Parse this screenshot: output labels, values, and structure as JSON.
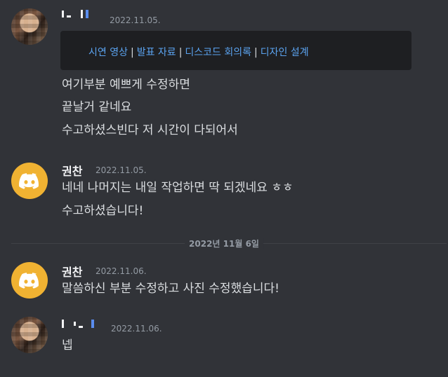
{
  "messages": [
    {
      "author_display": "",
      "timestamp": "2022.11.05.",
      "embed_links": [
        "시연 영상",
        "발표 자료",
        "디스코드 회의록",
        "디자인 설계"
      ],
      "embed_separator": "|",
      "lines": [
        "여기부분 예쁘게 수정하면",
        "끝날거 같네요",
        "수고하셨스빈다 저 시간이 다되어서"
      ]
    },
    {
      "author": "권찬",
      "timestamp": "2022.11.05.",
      "lines": [
        "네네 나머지는 내일 작업하면 딱 되겠네요 ㅎㅎ",
        "수고하셨습니다!"
      ]
    },
    {
      "author": "권찬",
      "timestamp": "2022.11.06.",
      "lines": [
        "말씀하신 부분 수정하고 사진 수정했습니다!"
      ]
    },
    {
      "author_display": "",
      "timestamp": "2022.11.06.",
      "lines": [
        "넵"
      ]
    }
  ],
  "date_divider": "2022년 11월 6일",
  "colors": {
    "background": "#313338",
    "embed_bg": "#1e1f22",
    "link": "#5ba3f0",
    "discord_avatar": "#f0b232",
    "timestamp": "#949ba4"
  },
  "icons": [
    "discord-logo-icon"
  ]
}
